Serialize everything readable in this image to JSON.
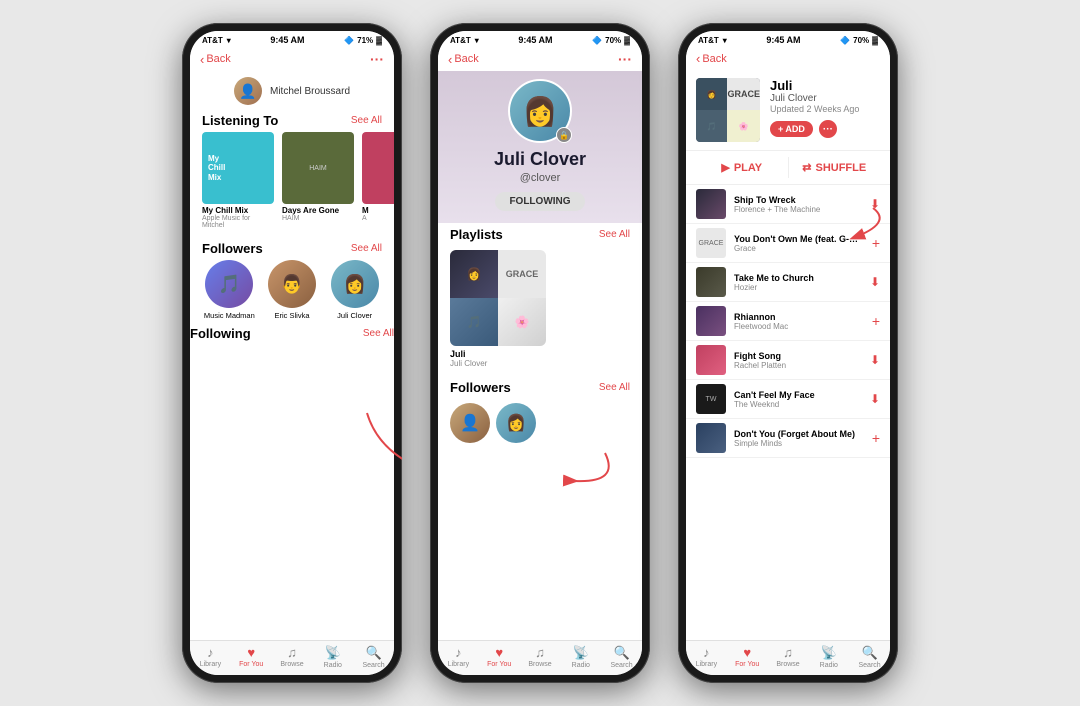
{
  "scene": {
    "bg_color": "#e8e8e8"
  },
  "phones": [
    {
      "id": "phone1",
      "status": {
        "carrier": "AT&T",
        "time": "9:45 AM",
        "battery": "71%"
      },
      "nav": {
        "back": "Back",
        "user": "Mitchel Broussard"
      },
      "sections": {
        "listening_to": {
          "title": "Listening To",
          "see_all": "See All",
          "albums": [
            {
              "name": "My Chill Mix",
              "sub": "Apple Music for Mitchel",
              "type": "chill"
            },
            {
              "name": "Days Are Gone",
              "sub": "HAIM",
              "type": "haim"
            },
            {
              "name": "M",
              "sub": "A",
              "type": "third"
            }
          ]
        },
        "followers": {
          "title": "Followers",
          "see_all": "See All",
          "people": [
            {
              "name": "Music Madman",
              "type": "musicmadman"
            },
            {
              "name": "Eric Slivka",
              "type": "ericslivka"
            },
            {
              "name": "Juli Clover",
              "type": "juliclover"
            }
          ]
        },
        "following": {
          "title": "Following",
          "see_all": "See All"
        }
      },
      "tabs": [
        "Library",
        "For You",
        "Browse",
        "Radio",
        "Search"
      ],
      "active_tab": 1
    },
    {
      "id": "phone2",
      "status": {
        "carrier": "AT&T",
        "time": "9:45 AM",
        "battery": "70%"
      },
      "nav": {
        "back": "Back"
      },
      "profile": {
        "name": "Juli Clover",
        "handle": "@clover",
        "following_btn": "FOLLOWING"
      },
      "sections": {
        "playlists": {
          "title": "Playlists",
          "see_all": "See All",
          "items": [
            {
              "name": "Juli",
              "sub": "Juli Clover"
            }
          ]
        },
        "followers": {
          "title": "Followers",
          "see_all": "See All"
        }
      },
      "tabs": [
        "Library",
        "For You",
        "Browse",
        "Radio",
        "Search"
      ],
      "active_tab": 1
    },
    {
      "id": "phone3",
      "status": {
        "carrier": "AT&T",
        "time": "9:45 AM",
        "battery": "70%"
      },
      "nav": {
        "back": "Back"
      },
      "playlist_header": {
        "title": "Juli",
        "subtitle": "Juli Clover",
        "updated": "Updated 2 Weeks Ago",
        "add_btn": "+ ADD"
      },
      "controls": {
        "play": "PLAY",
        "shuffle": "SHUFFLE"
      },
      "songs": [
        {
          "name": "Ship To Wreck",
          "artist": "Florence + The Machine",
          "action": "download",
          "art": "sa-1"
        },
        {
          "name": "You Don't Own Me (feat. G-Eazy)",
          "artist": "Grace",
          "action": "plus",
          "art": "sa-2"
        },
        {
          "name": "Take Me to Church",
          "artist": "Hozier",
          "action": "download",
          "art": "sa-3"
        },
        {
          "name": "Rhiannon",
          "artist": "Fleetwood Mac",
          "action": "plus",
          "art": "sa-4"
        },
        {
          "name": "Fight Song",
          "artist": "Rachel Platten",
          "action": "download",
          "art": "sa-5"
        },
        {
          "name": "Can't Feel My Face",
          "artist": "The Weeknd",
          "action": "download",
          "art": "sa-6"
        },
        {
          "name": "Don't You (Forget About Me)",
          "artist": "Simple Minds",
          "action": "plus",
          "art": "sa-7"
        }
      ],
      "tabs": [
        "Library",
        "For You",
        "Browse",
        "Radio",
        "Search"
      ],
      "active_tab": 1
    }
  ]
}
